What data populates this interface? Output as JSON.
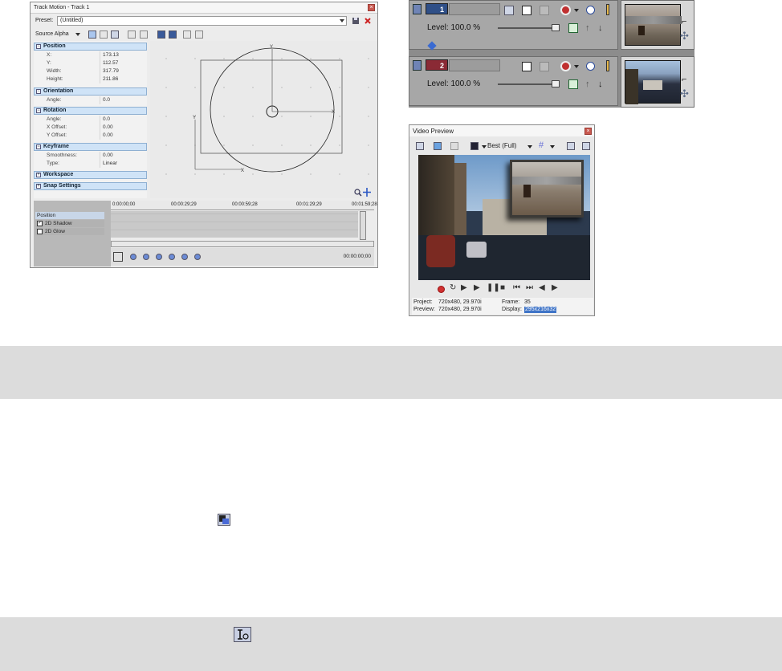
{
  "track_motion": {
    "title": "Track Motion - Track 1",
    "preset_label": "Preset:",
    "preset_value": "(Untitled)",
    "source_alpha_label": "Source Alpha",
    "sections": {
      "position": "Position",
      "orientation": "Orientation",
      "rotation": "Rotation",
      "keyframe": "Keyframe",
      "workspace": "Workspace",
      "snap": "Snap Settings"
    },
    "position_props": [
      {
        "key": "X:",
        "value": "173.13"
      },
      {
        "key": "Y:",
        "value": "112.57"
      },
      {
        "key": "Width:",
        "value": "317.79"
      },
      {
        "key": "Height:",
        "value": "211.86"
      }
    ],
    "orientation_props": [
      {
        "key": "Angle:",
        "value": "0.0"
      }
    ],
    "rotation_props": [
      {
        "key": "Angle:",
        "value": "0.0"
      },
      {
        "key": "X Offset:",
        "value": "0.00"
      },
      {
        "key": "Y Offset:",
        "value": "0.00"
      }
    ],
    "keyframe_props": [
      {
        "key": "Smoothness:",
        "value": "0.00"
      },
      {
        "key": "Type:",
        "value": "Linear"
      }
    ],
    "canvas_axis_x": "X",
    "canvas_axis_y": "Y",
    "timeline": {
      "ticks": [
        "0:00:00;00",
        "00:00:29;29",
        "00:00:59;28",
        "00:01:29;29",
        "00:01:59;28"
      ],
      "tracks": [
        {
          "label": "Position",
          "checked": null
        },
        {
          "label": "2D Shadow",
          "checked": true
        },
        {
          "label": "2D Glow",
          "checked": false
        }
      ],
      "timecode": "00:00:00;00"
    }
  },
  "tracks": [
    {
      "number": "1",
      "level": "Level: 100.0 %",
      "color": "#2f4f87"
    },
    {
      "number": "2",
      "level": "Level: 100.0 %",
      "color": "#8a2a35"
    }
  ],
  "video_preview": {
    "title": "Video Preview",
    "quality": "Best (Full)",
    "project_label": "Project:",
    "project_value": "720x480, 29.970i",
    "preview_label": "Preview:",
    "preview_value": "720x480, 29.970i",
    "frame_label": "Frame:",
    "frame_value": "35",
    "display_label": "Display:",
    "display_value": "295x216x32"
  },
  "colors": {
    "selection_blue": "#cfe3f7",
    "record_red": "#d03030",
    "graybar": "#dcdcdc"
  },
  "icons": [
    "enable-workspace-icon",
    "mask-icon",
    "lock-aspect-icon"
  ]
}
